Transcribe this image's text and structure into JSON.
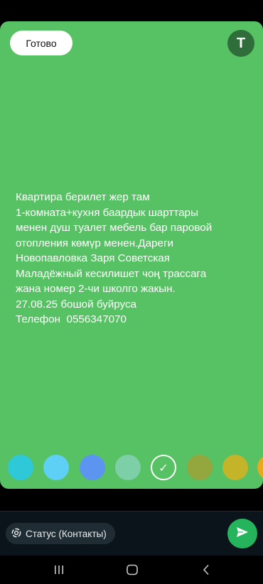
{
  "toolbar": {
    "done_label": "Готово",
    "text_tool_label": "T"
  },
  "status_text": "Квартира берилет жер там\n1-комната+кухня баардык шарттары\nменен душ туалет мебель бар паровой\nотопления көмүр менен.Дареги\nНовопавловка Заря Советская\nМаладёжный кесилишет чоң трассага\nжана номер 2-чи школго жакын.\n27.08.25 бошой буйруса\nТелефон  0556347070",
  "background_color": "#57c264",
  "palette": {
    "colors": [
      "#2fc8d8",
      "#5ed0f5",
      "#5b95f0",
      "#7ccfa6",
      "#57c264",
      "#94a63e",
      "#c3b42a",
      "#e8a820"
    ],
    "selected_index": 4,
    "selected_icon": "checkmark-icon"
  },
  "composer": {
    "audience_icon": "status-ring-icon",
    "audience_label": "Статус (Контакты)",
    "send_icon": "send-arrow-icon"
  },
  "navigation": {
    "icons": [
      "recent-apps-icon",
      "home-icon",
      "back-icon"
    ]
  }
}
